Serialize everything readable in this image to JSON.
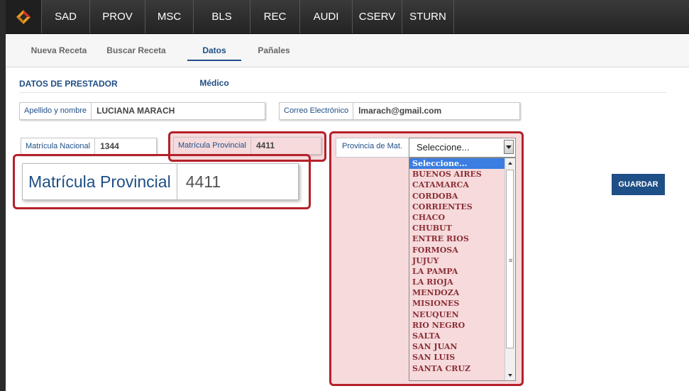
{
  "nav": {
    "logo_icon": "diamond-logo-icon",
    "items": [
      "SAD",
      "PROV",
      "MSC",
      "BLS",
      "REC",
      "AUDI",
      "CSERV",
      "STURN"
    ]
  },
  "subnav": {
    "tabs": [
      "Nueva Receta",
      "Buscar Receta",
      "Datos Médico",
      "Pañales"
    ],
    "active_tab": "Datos Médico"
  },
  "section": {
    "title": "DATOS DE PRESTADOR"
  },
  "form": {
    "nombre": {
      "label": "Apellido y nombre",
      "value": "LUCIANA MARACH"
    },
    "correo": {
      "label": "Correo Electrónico",
      "value": "lmarach@gmail.com"
    },
    "mat_nacional": {
      "label": "Matrícula Nacional",
      "value": "1344"
    },
    "mat_provincial": {
      "label": "Matrícula Provincial",
      "value": "4411"
    },
    "provincia": {
      "label": "Provincia de Mat.",
      "selected": "Seleccione...",
      "options": [
        "Seleccione...",
        "BUENOS AIRES",
        "CATAMARCA",
        "CORDOBA",
        "CORRIENTES",
        "CHACO",
        "CHUBUT",
        "ENTRE RIOS",
        "FORMOSA",
        "JUJUY",
        "LA PAMPA",
        "LA RIOJA",
        "MENDOZA",
        "MISIONES",
        "NEUQUEN",
        "RIO NEGRO",
        "SALTA",
        "SAN JUAN",
        "SAN LUIS",
        "SANTA CRUZ"
      ]
    }
  },
  "zoom": {
    "label": "Matrícula Provincial",
    "value": "4411"
  },
  "actions": {
    "save_label": "GUARDAR"
  },
  "colors": {
    "accent": "#1f4e86",
    "highlight": "#b5202b"
  }
}
